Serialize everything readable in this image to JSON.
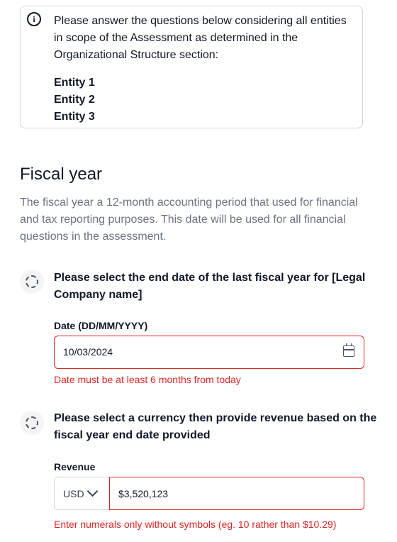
{
  "info": {
    "icon": "info-icon",
    "text": "Please answer the questions below considering all entities in scope of the Assessment as determined in the Organizational Structure section:",
    "entities": [
      "Entity 1",
      "Entity 2",
      "Entity 3"
    ]
  },
  "section": {
    "title": "Fiscal year",
    "description": "The fiscal year a 12-month accounting period that used for financial and tax reporting purposes. This date will be used for all financial questions in the assessment."
  },
  "q1": {
    "icon": "dashed-circle-icon",
    "question": "Please select the end date of the last fiscal year for [Legal Company name]",
    "label": "Date (DD/MM/YYYY)",
    "value": "10/03/2024",
    "error": "Date must be at least 6 months from today"
  },
  "q2": {
    "icon": "dashed-circle-icon",
    "question": "Please select a currency then provide revenue based on the fiscal year end date provided",
    "label": "Revenue",
    "currency": "USD",
    "value": "$3,520,123",
    "error": "Enter numerals only without symbols (eg. 10 rather than $10.29)"
  },
  "colors": {
    "error": "#dc2626",
    "text": "#111827",
    "muted": "#6b7280",
    "border": "#d1d5db"
  }
}
